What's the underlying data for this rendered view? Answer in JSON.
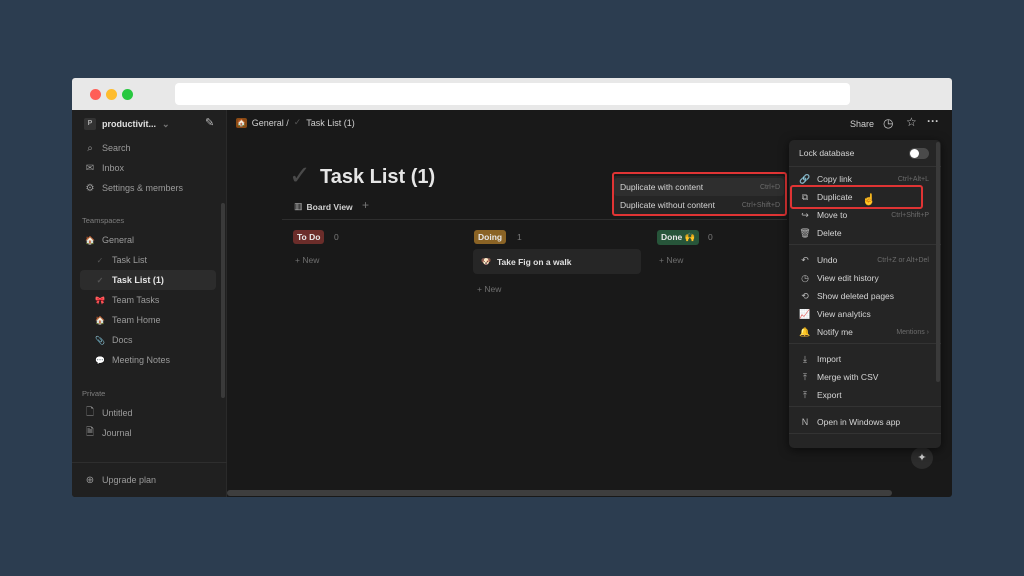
{
  "window": {
    "dots": [
      "#ff5f57",
      "#febc2e",
      "#28c840"
    ]
  },
  "sidebar": {
    "workspace": {
      "initial": "P",
      "name": "productivit..."
    },
    "top": [
      {
        "label": "Search",
        "icon": "search-icon",
        "glyph": "⌕"
      },
      {
        "label": "Inbox",
        "icon": "inbox-icon",
        "glyph": "✉"
      },
      {
        "label": "Settings & members",
        "icon": "gear-icon",
        "glyph": "⚙"
      }
    ],
    "teamspaces_label": "Teamspaces",
    "teamspaces": [
      {
        "label": "General",
        "icon": "house-icon",
        "glyph": "🏠"
      },
      {
        "label": "Task List",
        "icon": "check-icon",
        "glyph": "✓",
        "sub": true
      },
      {
        "label": "Task List (1)",
        "icon": "check-icon",
        "glyph": "✓",
        "sub": true,
        "active": true
      },
      {
        "label": "Team Tasks",
        "icon": "gift-icon",
        "glyph": "🎀",
        "sub": true
      },
      {
        "label": "Team Home",
        "icon": "home-icon",
        "glyph": "🏠",
        "sub": true
      },
      {
        "label": "Docs",
        "icon": "paperclip-icon",
        "glyph": "📎",
        "sub": true
      },
      {
        "label": "Meeting Notes",
        "icon": "speech-bubble-icon",
        "glyph": "💬",
        "sub": true
      }
    ],
    "private_label": "Private",
    "private": [
      {
        "label": "Untitled",
        "icon": "page-icon",
        "glyph": "🗋"
      },
      {
        "label": "Journal",
        "icon": "page-icon",
        "glyph": "🗎"
      }
    ],
    "upgrade": "Upgrade plan"
  },
  "header": {
    "breadcrumb": [
      "General /",
      "Task List (1)"
    ],
    "share": "Share"
  },
  "page": {
    "title": "Task List (1)",
    "view": "Board View"
  },
  "board": {
    "columns": [
      {
        "label": "To Do",
        "count": "0",
        "color": "#6b2d2a",
        "new": "New"
      },
      {
        "label": "Doing",
        "count": "1",
        "color": "#8a6325",
        "new": "New",
        "cards": [
          "Take Fig on a walk"
        ]
      },
      {
        "label": "Done 🙌",
        "count": "0",
        "color": "#27553a",
        "new": "New"
      }
    ]
  },
  "submenu": [
    {
      "label": "Duplicate with content",
      "kb": "Ctrl+D"
    },
    {
      "label": "Duplicate without content",
      "kb": "Ctrl+Shift+D"
    }
  ],
  "menu": {
    "lock": "Lock database",
    "lock_on": false,
    "items": [
      {
        "label": "Copy link",
        "kb": "Ctrl+Alt+L",
        "icon": "link-icon",
        "glyph": "🔗"
      },
      {
        "label": "Duplicate",
        "kb": "",
        "icon": "duplicate-icon",
        "glyph": "⧉"
      },
      {
        "label": "Move to",
        "kb": "Ctrl+Shift+P",
        "icon": "move-arrow-icon",
        "glyph": "↪"
      },
      {
        "label": "Delete",
        "kb": "",
        "icon": "trash-icon",
        "glyph": "🗑"
      },
      {
        "label": "Undo",
        "kb": "Ctrl+Z or Alt+Del",
        "icon": "undo-icon",
        "glyph": "↶"
      },
      {
        "label": "View edit history",
        "kb": "",
        "icon": "clock-icon",
        "glyph": "◷"
      },
      {
        "label": "Show deleted pages",
        "kb": "",
        "icon": "restore-icon",
        "glyph": "⟲"
      },
      {
        "label": "View analytics",
        "kb": "",
        "icon": "chart-icon",
        "glyph": "📈"
      },
      {
        "label": "Notify me",
        "kb": "Mentions ›",
        "icon": "bell-icon",
        "glyph": "🔔"
      },
      {
        "label": "Import",
        "kb": "",
        "icon": "import-icon",
        "glyph": "⤓"
      },
      {
        "label": "Merge with CSV",
        "kb": "",
        "icon": "merge-icon",
        "glyph": "⤒"
      },
      {
        "label": "Export",
        "kb": "",
        "icon": "export-icon",
        "glyph": "⤒"
      },
      {
        "label": "Open in Windows app",
        "kb": "",
        "icon": "notion-icon",
        "glyph": "N"
      }
    ]
  }
}
